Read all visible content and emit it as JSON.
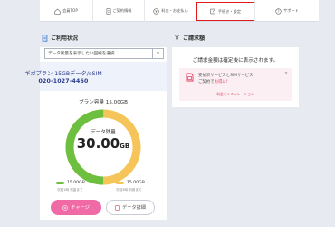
{
  "nav": {
    "items": [
      {
        "label": "会員TOP",
        "icon": "home-icon"
      },
      {
        "label": "ご契約情報",
        "icon": "document-icon"
      },
      {
        "label": "料金・お支払い",
        "icon": "yen-icon"
      },
      {
        "label": "手続き・設定",
        "icon": "settings-edit-icon",
        "active": true
      },
      {
        "label": "サポート",
        "icon": "help-icon"
      }
    ],
    "active_border_color": "#e11b1b"
  },
  "usage": {
    "title": "ご利用状況",
    "select_placeholder": "データ残量を表示したい回線を選択",
    "plan_name": "ギガプラン 15GBデータ/eSIM",
    "phone_number": "020-1027-4460",
    "capacity_text": "プラン容量 15.00GB",
    "remaining_label": "データ残量",
    "remaining_value": "30.00",
    "remaining_unit": "GB",
    "legend_green": {
      "value": "15.00GB",
      "sub": "次回1時 残量まで",
      "color": "#6dbf3f"
    },
    "legend_yellow": {
      "value": "15.00GB",
      "sub": "次回3時 利用まで",
      "color": "#f5c55a"
    },
    "donut_fraction_green": 0.5,
    "charge_button": "チャージ",
    "detail_button": "データ詳細"
  },
  "billing": {
    "title": "ご請求額",
    "message": "ご請求金額は確定後に表示されます。",
    "info_line1": "支払済サービスとSIMサービス",
    "info_line2": "ご契約で",
    "info_line2_red": "お得に！",
    "info_link": "料金をシミュレーション",
    "info_close": "×"
  },
  "colors": {
    "charge": "#f06aa6",
    "plan_text": "#2b3a8c",
    "accent_red": "#e03a5b"
  }
}
